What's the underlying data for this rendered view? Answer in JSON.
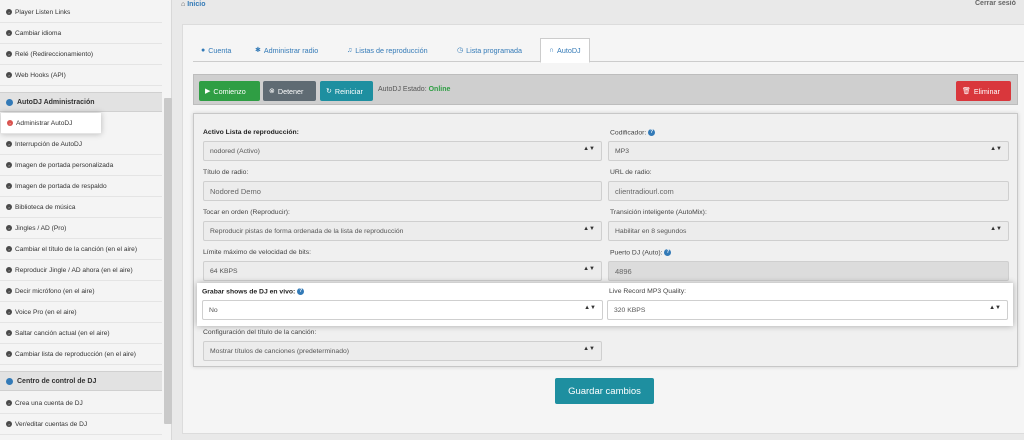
{
  "header": {
    "home": "Inicio",
    "logout": "Cerrar sesió"
  },
  "sidebar": {
    "items_top": [
      {
        "label": "Player Listen Links"
      },
      {
        "label": "Cambiar idioma"
      },
      {
        "label": "Relé (Redireccionamiento)"
      },
      {
        "label": "Web Hooks (API)"
      }
    ],
    "section_autodj": "AutoDJ Administración",
    "items_autodj": [
      {
        "label": "Administrar AutoDJ"
      },
      {
        "label": "Interrupción de AutoDJ"
      },
      {
        "label": "Imagen de portada personalizada"
      },
      {
        "label": "Imagen de portada de respaldo"
      },
      {
        "label": "Biblioteca de música"
      },
      {
        "label": "Jingles / AD (Pro)"
      },
      {
        "label": "Cambiar el título de la canción (en el aire)"
      },
      {
        "label": "Reproducir Jingle / AD ahora (en el aire)"
      },
      {
        "label": "Decir micrófono (en el aire)"
      },
      {
        "label": "Voice Pro (en el aire)"
      },
      {
        "label": "Saltar canción actual (en el aire)"
      },
      {
        "label": "Cambiar lista de reproducción (en el aire)"
      }
    ],
    "section_dj": "Centro de control de DJ",
    "items_dj": [
      {
        "label": "Crea una cuenta de DJ"
      },
      {
        "label": "Ver/editar cuentas de DJ"
      }
    ]
  },
  "tabs": [
    {
      "label": "Cuenta",
      "icon": "user-icon"
    },
    {
      "label": "Administrar radio",
      "icon": "gear-icon"
    },
    {
      "label": "Listas de reproducción",
      "icon": "music-icon"
    },
    {
      "label": "Lista programada",
      "icon": "clock-icon"
    },
    {
      "label": "AutoDJ",
      "icon": "headphones-icon"
    }
  ],
  "toolbar": {
    "start": "Comienzo",
    "stop": "Detener",
    "restart": "Reiniciar",
    "status_label": "AutoDJ Estado:",
    "status_value": "Online",
    "delete": "Eliminar"
  },
  "form": {
    "playlist_label": "Activo Lista de reproducción:",
    "playlist_value": "nodored (Activo)",
    "codec_label": "Codificador:",
    "codec_value": "MP3",
    "title_label": "Título de radio:",
    "title_value": "Nodored Demo",
    "url_label": "URL de radio:",
    "url_value": "clientradiourl.com",
    "order_label": "Tocar en orden (Reproducir):",
    "order_value": "Reproducir pistas de forma ordenada de la lista de reproducción",
    "transition_label": "Transición inteligente (AutoMix):",
    "transition_value": "Habilitar en 8 segundos",
    "bitrate_label": "Límite máximo de velocidad de bits:",
    "bitrate_value": "64 KBPS",
    "port_label": "Puerto DJ (Auto):",
    "port_value": "4896",
    "record_label": "Grabar shows de DJ en vivo:",
    "record_value": "No",
    "quality_label": "Live Record MP3 Quality:",
    "quality_value": "320 KBPS",
    "songtitle_label": "Configuración del título de la canción:",
    "songtitle_value": "Mostrar títulos de canciones (predeterminado)",
    "help_glyph": "?",
    "arrow_glyph": "▲▼",
    "save": "Guardar cambios"
  },
  "colors": {
    "accent": "#337ab7",
    "start": "#2f9e44",
    "restart": "#1e8fa0",
    "delete": "#d9373c",
    "online": "#2f9e44"
  }
}
